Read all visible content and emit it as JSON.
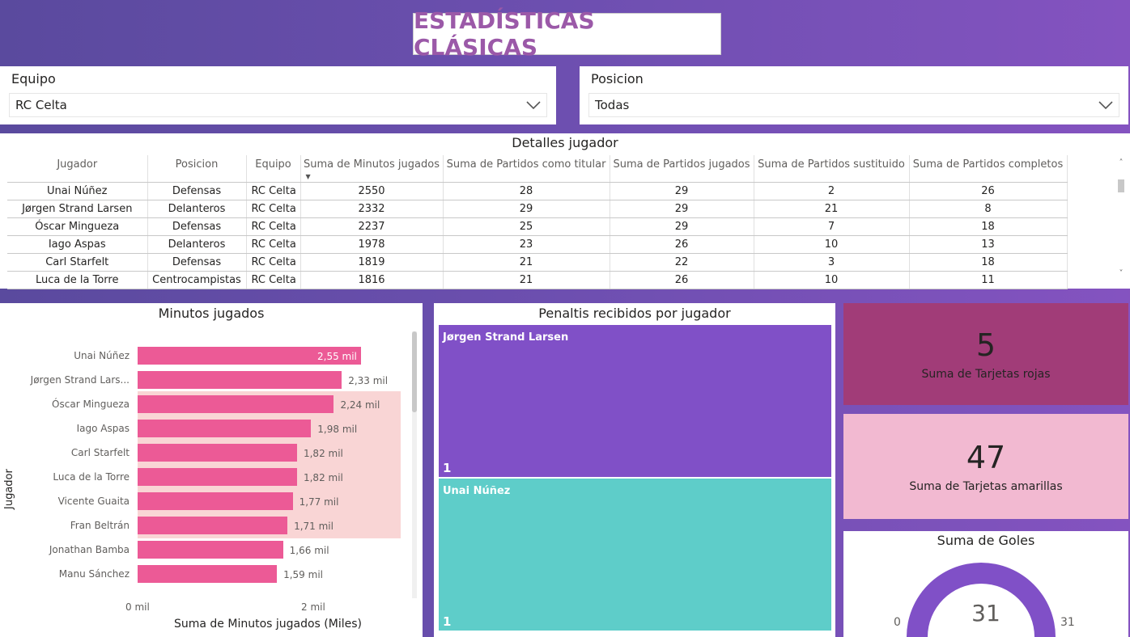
{
  "title": "ESTADÍSTICAS CLÁSICAS",
  "colors": {
    "accent": "#7e4fc0",
    "bar": "#ec5a96",
    "treemap_a": "#8050c7",
    "treemap_b": "#5ecdc9",
    "card_red": "#a13c78",
    "card_yellow": "#f2b9d1",
    "gauge": "#8050c7"
  },
  "slicers": {
    "equipo": {
      "label": "Equipo",
      "value": "RC Celta"
    },
    "posicion": {
      "label": "Posicion",
      "value": "Todas"
    }
  },
  "table": {
    "title": "Detalles jugador",
    "columns": [
      "Jugador",
      "Posicion",
      "Equipo",
      "Suma de Minutos jugados",
      "Suma de Partidos como titular",
      "Suma de Partidos jugados",
      "Suma de Partidos sustituido",
      "Suma de Partidos completos"
    ],
    "rows": [
      [
        "Unai Núñez",
        "Defensas",
        "RC Celta",
        "2550",
        "28",
        "29",
        "2",
        "26"
      ],
      [
        "Jørgen Strand Larsen",
        "Delanteros",
        "RC Celta",
        "2332",
        "29",
        "29",
        "21",
        "8"
      ],
      [
        "Óscar Mingueza",
        "Defensas",
        "RC Celta",
        "2237",
        "25",
        "29",
        "7",
        "18"
      ],
      [
        "Iago Aspas",
        "Delanteros",
        "RC Celta",
        "1978",
        "23",
        "26",
        "10",
        "13"
      ],
      [
        "Carl Starfelt",
        "Defensas",
        "RC Celta",
        "1819",
        "21",
        "22",
        "3",
        "18"
      ],
      [
        "Luca de la Torre",
        "Centrocampistas",
        "RC Celta",
        "1816",
        "21",
        "26",
        "10",
        "11"
      ]
    ]
  },
  "chart_data": {
    "type": "bar",
    "title": "Minutos jugados",
    "ylabel": "Jugador",
    "xlabel": "Suma de Minutos jugados (Miles)",
    "x_ticks": [
      "0 mil",
      "2 mil"
    ],
    "xlim": [
      0,
      3.25
    ],
    "categories": [
      "Unai Núñez",
      "Jørgen Strand Lars...",
      "Óscar Mingueza",
      "Iago Aspas",
      "Carl Starfelt",
      "Luca de la Torre",
      "Vicente Guaita",
      "Fran Beltrán",
      "Jonathan Bamba",
      "Manu Sánchez"
    ],
    "values": [
      2.55,
      2.33,
      2.24,
      1.98,
      1.82,
      1.82,
      1.77,
      1.71,
      1.66,
      1.59
    ],
    "labels": [
      "2,55 mil",
      "2,33 mil",
      "2,24 mil",
      "1,98 mil",
      "1,82 mil",
      "1,82 mil",
      "1,77 mil",
      "1,71 mil",
      "1,66 mil",
      "1,59 mil"
    ]
  },
  "treemap": {
    "title": "Penaltis recibidos por jugador",
    "items": [
      {
        "name": "Jørgen Strand Larsen",
        "value": "1"
      },
      {
        "name": "Unai Núñez",
        "value": "1"
      }
    ]
  },
  "cards": {
    "rojas": {
      "value": "5",
      "label": "Suma de Tarjetas rojas"
    },
    "amarillas": {
      "value": "47",
      "label": "Suma de Tarjetas amarillas"
    }
  },
  "gauge": {
    "title": "Suma de Goles",
    "value": "31",
    "min": "0",
    "max": "31"
  }
}
